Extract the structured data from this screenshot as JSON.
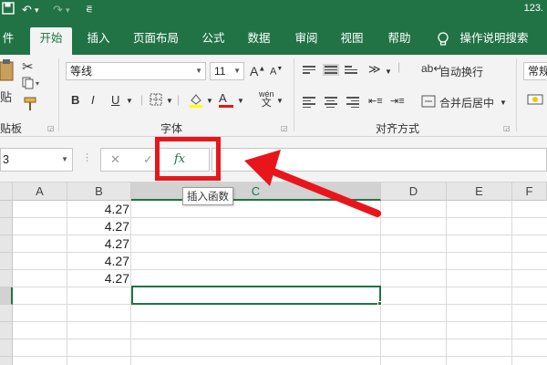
{
  "titlebar": {
    "save_icon": "save-icon",
    "undo_icon": "undo-icon",
    "undo_arrow": "↶",
    "undo_menu": "▾",
    "redo_icon": "redo-icon",
    "redo_arrow": "↷",
    "redo_menu": "▾",
    "customize": "⋷",
    "doc_title": "123."
  },
  "tabs": [
    {
      "label": "件"
    },
    {
      "label": "开始"
    },
    {
      "label": "插入"
    },
    {
      "label": "页面布局"
    },
    {
      "label": "公式"
    },
    {
      "label": "数据"
    },
    {
      "label": "审阅"
    },
    {
      "label": "视图"
    },
    {
      "label": "帮助"
    },
    {
      "label": "操作说明搜索"
    }
  ],
  "ribbon": {
    "clipboard": {
      "paste_label": "贴",
      "group_label": "贴板"
    },
    "font": {
      "font_name": "等线",
      "font_size": "11",
      "grow": "A",
      "shrink": "A",
      "bold": "B",
      "italic": "I",
      "underline": "U",
      "font_color_glyph": "A",
      "phonetic_top": "wén",
      "phonetic_bottom": "文",
      "group_label": "字体"
    },
    "alignment": {
      "wrap_text": "自动换行",
      "merge_center": "合并后居中",
      "group_label": "对齐方式"
    },
    "number": {
      "format": "常规"
    }
  },
  "formula_bar": {
    "name_box": "3",
    "cancel": "✕",
    "enter": "✓",
    "insert_function": "fx",
    "tooltip": "插入函数"
  },
  "grid": {
    "columns": [
      "A",
      "B",
      "C",
      "D",
      "E",
      "F"
    ],
    "cells_b": [
      "4.27",
      "4.27",
      "4.27",
      "4.27",
      "4.27"
    ]
  },
  "colors": {
    "accent": "#217346",
    "highlight": "#e8161b"
  }
}
